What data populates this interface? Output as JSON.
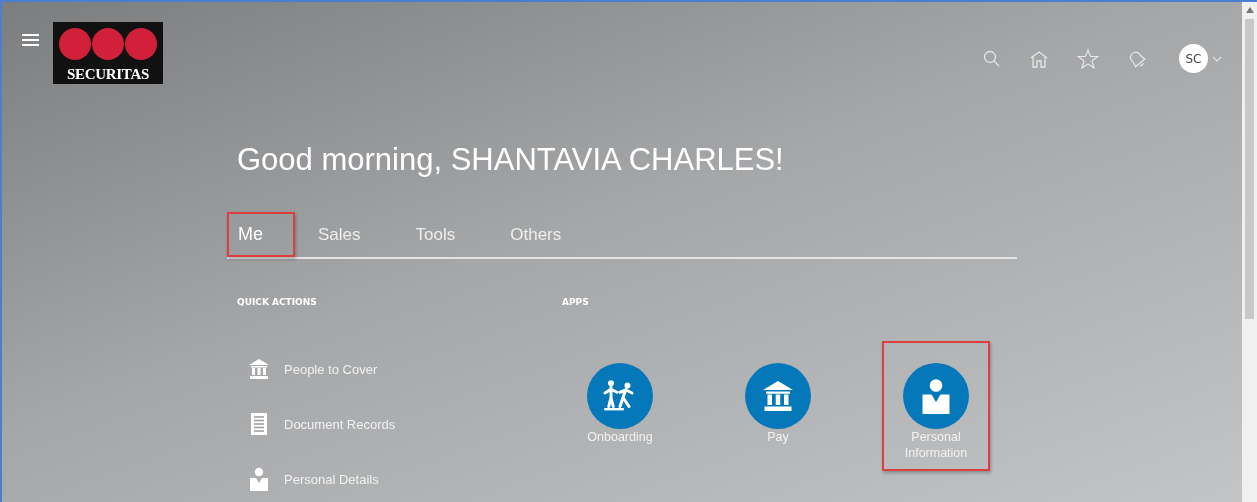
{
  "header": {
    "logo": {
      "text": "SECURITAS"
    },
    "avatar": {
      "initials": "SC"
    }
  },
  "greeting": "Good morning, SHANTAVIA CHARLES!",
  "tabs": [
    {
      "label": "Me",
      "selected": true,
      "highlighted": true
    },
    {
      "label": "Sales",
      "selected": false,
      "highlighted": false
    },
    {
      "label": "Tools",
      "selected": false,
      "highlighted": false
    },
    {
      "label": "Others",
      "selected": false,
      "highlighted": false
    }
  ],
  "quick_actions": {
    "title": "QUICK ACTIONS",
    "items": [
      {
        "label": "People to Cover",
        "kind": "bank"
      },
      {
        "label": "Document Records",
        "kind": "document"
      },
      {
        "label": "Personal Details",
        "kind": "person"
      }
    ]
  },
  "apps": {
    "title": "APPS",
    "items": [
      {
        "label": "Onboarding",
        "kind": "walkers",
        "highlighted": false
      },
      {
        "label": "Pay",
        "kind": "bank",
        "highlighted": false
      },
      {
        "label": "Personal Information",
        "kind": "person",
        "highlighted": true
      }
    ]
  }
}
